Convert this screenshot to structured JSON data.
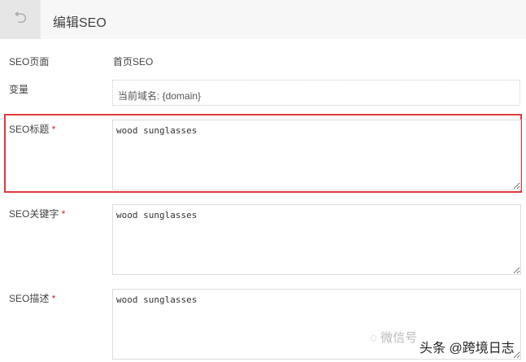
{
  "header": {
    "back_icon": "undo-arrow-icon",
    "title": "编辑SEO"
  },
  "form": {
    "page_label": "SEO页面",
    "page_value": "首页SEO",
    "variable_label": "变量",
    "variable_value": "当前域名: {domain}",
    "title_label": "SEO标题",
    "title_value": "wood sunglasses",
    "keywords_label": "SEO关键字",
    "keywords_value": "wood sunglasses",
    "desc_label": "SEO描述",
    "desc_value": "wood sunglasses",
    "required_mark": "*"
  },
  "watermark": {
    "wechat": "微信号",
    "toutiao": "头条 @跨境日志"
  },
  "colors": {
    "highlight": "#e03a3a",
    "required": "#e02020"
  }
}
